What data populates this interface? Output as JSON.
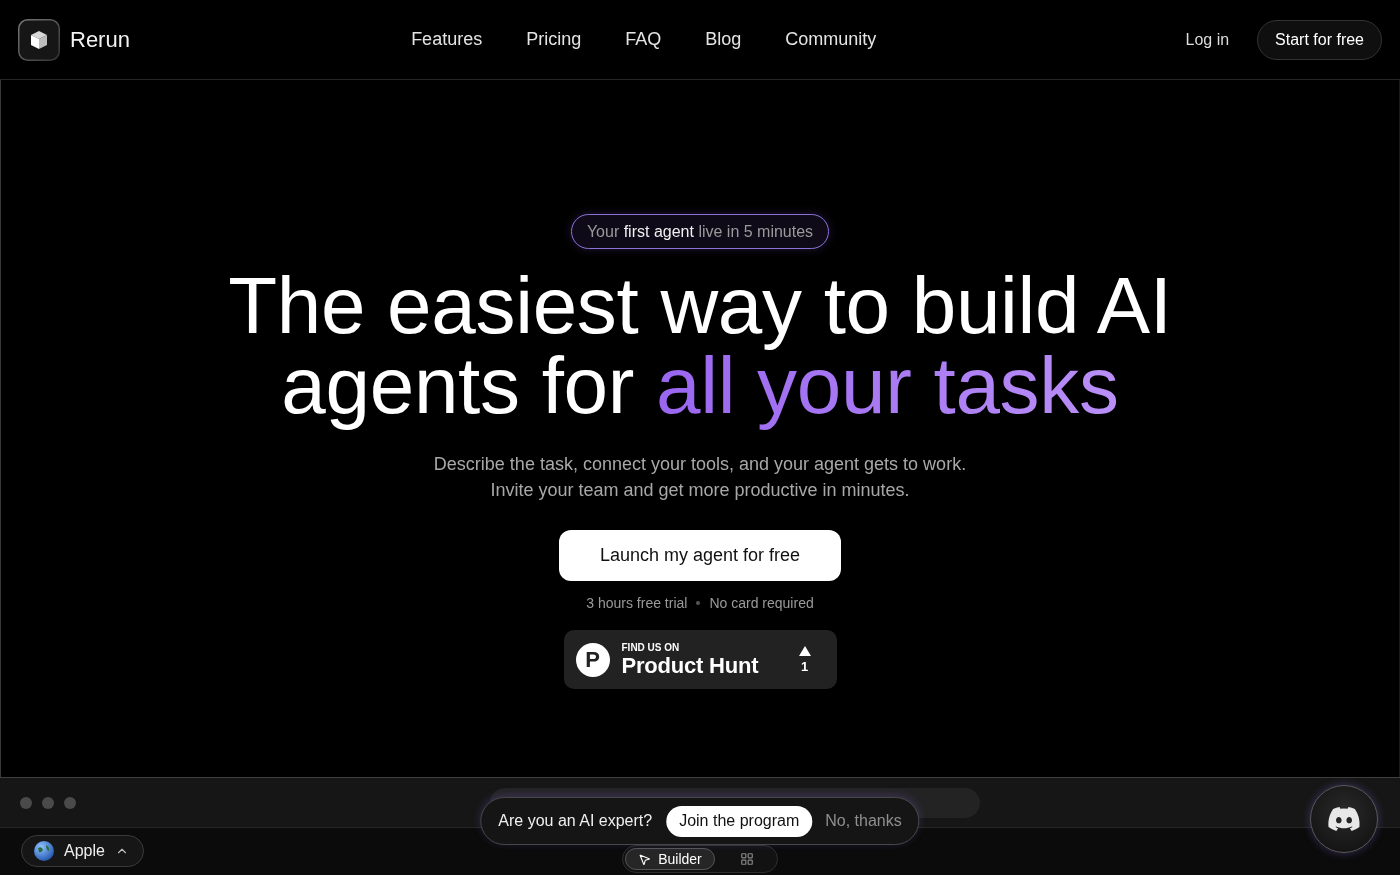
{
  "header": {
    "brand": "Rerun",
    "nav": [
      "Features",
      "Pricing",
      "FAQ",
      "Blog",
      "Community"
    ],
    "login": "Log in",
    "cta": "Start for free"
  },
  "hero": {
    "badge": "Your **first agent** live in 5 minutes",
    "title": "The easiest way to build AI agents for",
    "title_highlight": "all your tasks",
    "subtitle": [
      "Describe the task, connect your tools, and your agent gets to work.",
      "Invite your team and get more productive in minutes."
    ],
    "cta": "Launch my agent for free",
    "notes": [
      "3 hours free trial",
      "No card required"
    ],
    "product_hunt": {
      "logo_letter": "P",
      "kicker": "FIND US ON",
      "name": "Product Hunt",
      "votes": "1"
    }
  },
  "preview": {
    "chip": "Apple",
    "tabs": [
      {
        "kind": "pointer",
        "label": "Builder",
        "selected": true
      },
      {
        "kind": "grid",
        "selected": false
      }
    ]
  },
  "expert_banner": {
    "question": "Are you an AI expert?",
    "join": "Join the program",
    "dismiss": "No, thanks"
  }
}
